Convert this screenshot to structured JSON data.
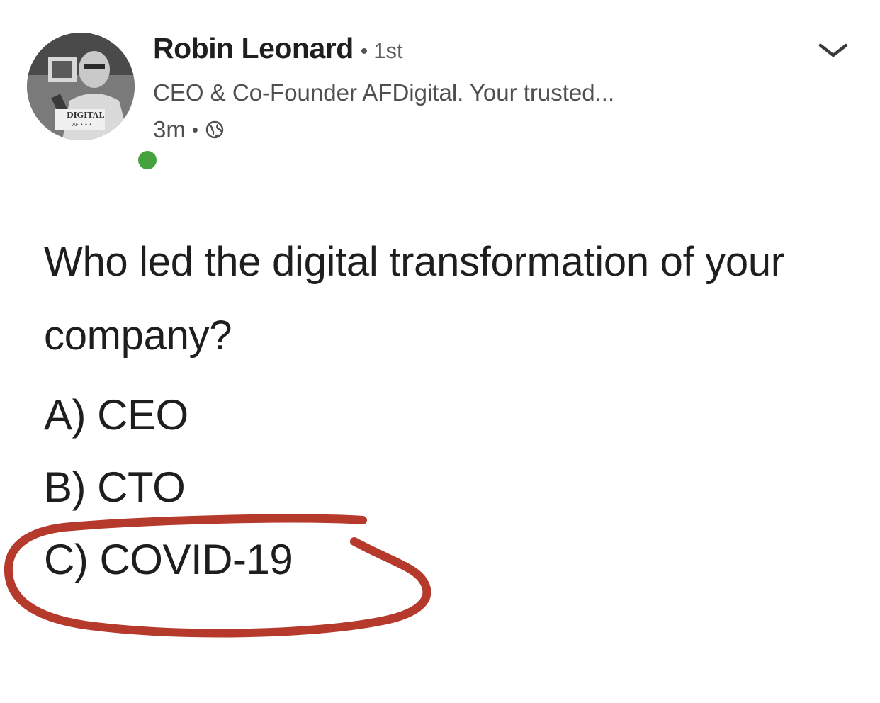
{
  "post": {
    "author": {
      "name": "Robin Leonard",
      "connection": "1st",
      "headline": "CEO & Co-Founder AFDigital. Your trusted...",
      "online": true,
      "avatar_text": "DIGITAL"
    },
    "timestamp": "3m",
    "visibility_icon": "globe-icon",
    "question": "Who led the digital transformation of your company?",
    "options": [
      {
        "label": "A) CEO"
      },
      {
        "label": "B) CTO"
      },
      {
        "label": "C) COVID-19"
      }
    ],
    "highlighted_option": 2,
    "highlight_color": "#b53a2c",
    "presence_color": "#46a23c"
  }
}
